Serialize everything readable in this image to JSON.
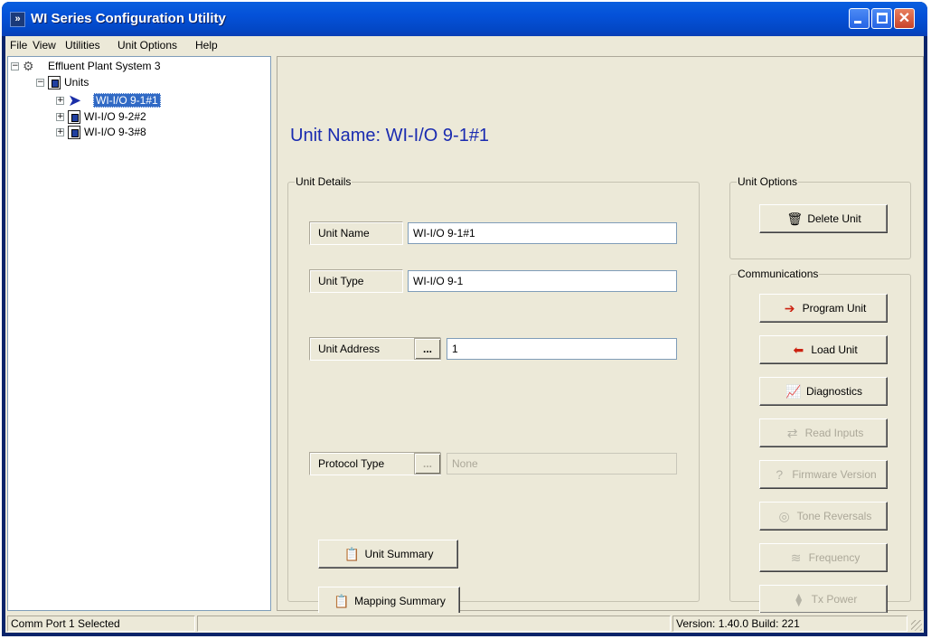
{
  "window": {
    "title": "WI Series Configuration Utility"
  },
  "menu": [
    {
      "label": "File"
    },
    {
      "label": "View"
    },
    {
      "label": "Utilities"
    },
    {
      "label": "Unit Options"
    },
    {
      "label": "Help"
    }
  ],
  "tree": {
    "root": "Effluent Plant System 3",
    "units_folder": "Units",
    "units": [
      {
        "label": "WI-I/O 9-1#1",
        "selected": true
      },
      {
        "label": "WI-I/O 9-2#2",
        "selected": false
      },
      {
        "label": "WI-I/O 9-3#8",
        "selected": false
      }
    ]
  },
  "heading": "Unit Name: WI-I/O 9-1#1",
  "unit_details": {
    "legend": "Unit Details",
    "unit_name_label": "Unit Name",
    "unit_name_value": "WI-I/O 9-1#1",
    "unit_type_label": "Unit Type",
    "unit_type_value": "WI-I/O 9-1",
    "unit_address_label": "Unit Address",
    "unit_address_value": "1",
    "protocol_type_label": "Protocol Type",
    "protocol_type_value": "None",
    "dots": "...",
    "unit_summary": "Unit Summary",
    "mapping_summary": "Mapping Summary"
  },
  "unit_options": {
    "legend": "Unit Options",
    "delete_unit": "Delete Unit"
  },
  "communications": {
    "legend": "Communications",
    "program_unit": "Program Unit",
    "load_unit": "Load Unit",
    "diagnostics": "Diagnostics",
    "read_inputs": "Read Inputs",
    "firmware_version": "Firmware Version",
    "tone_reversals": "Tone Reversals",
    "frequency": "Frequency",
    "tx_power": "Tx Power"
  },
  "status": {
    "left": "Comm Port 1 Selected",
    "right": "Version: 1.40.0 Build: 221"
  },
  "colors": {
    "titlebar": "#0451d8",
    "heading": "#1a2bb0",
    "selection": "#316ac5"
  }
}
